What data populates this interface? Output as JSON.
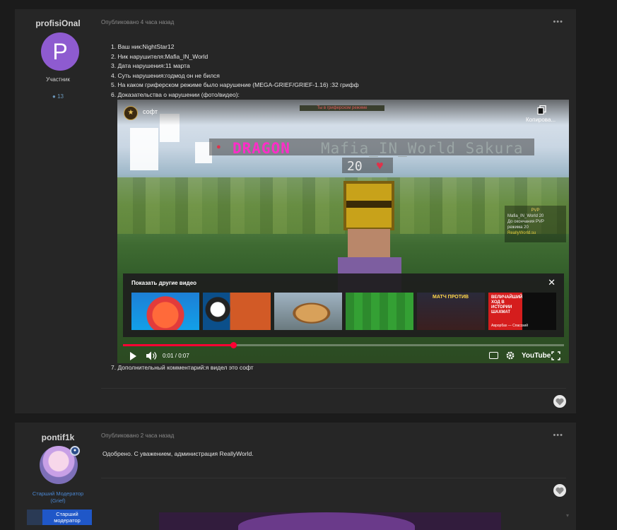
{
  "post1": {
    "author": "profisiOnal",
    "avatar_letter": "P",
    "role": "Участник",
    "reply_count": "13",
    "published": "Опубликовано 4 часа назад",
    "more": "•••",
    "lines": [
      "1. Ваш ник:NightStar12",
      "2. Ник нарушителя:Mafia_IN_World",
      "3. Дата нарушения:11 марта",
      "4. Суть нарушения:годмод он не бился",
      "5. На каком гриферском режиме было нарушение (MEGA-GRIEF/GRIEF-1.16) :32 грифф",
      "6. Доказательства о нарушении (фото/видео):"
    ],
    "footnote": "7. Дополнительный комментарий:я видел это софт",
    "video": {
      "title": "софт",
      "copy_label": "Копирова...",
      "server_bar": "Ты в гриферском режиме",
      "nametag_prefix": "DRAGON",
      "nametag_nick": "Mafia_IN_World Sakura",
      "health": "20",
      "scoreboard": {
        "title": "PVP",
        "line1": "Mafia_IN_World 20",
        "line2": "До окончания PVP",
        "line3": "режима 20",
        "site": "ReallyWorld.su"
      },
      "more_videos_title": "Показать другие видео",
      "thumb5_text": "МАТЧ ПРОТИВ",
      "thumb6_text": "ВЕЛИЧАЙШИЙ ХОД В ИСТОРИИ ШАХМАТ",
      "thumb6_sub": "Аврорбах — Спасский",
      "time": "0:01 / 0:07",
      "progress": 0.25,
      "logo": "YouTube"
    }
  },
  "post2": {
    "author": "pontif1k",
    "role_line1": "Старший Модератор",
    "role_line2": "(Grief)",
    "rank_line1": "Старший",
    "rank_line2": "модератор",
    "published": "Опубликовано 2 часа назад",
    "more": "•••",
    "text": "Одобрено. С уважением, администрация ReallyWorld."
  },
  "colors": {
    "page_bg": "#1b1b1b",
    "post_bg": "#262626",
    "avatar_purple": "#8e5bd0",
    "moderator_blue": "#4a86d0",
    "rank_blue": "#1f57c8",
    "youtube_red": "#ff0033"
  }
}
